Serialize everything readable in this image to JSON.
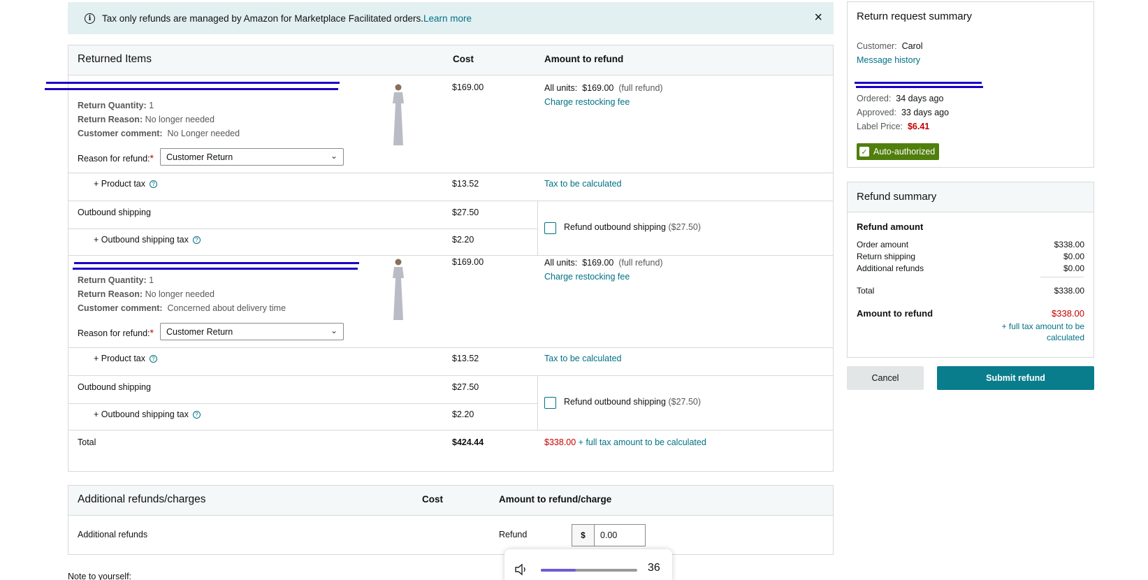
{
  "banner": {
    "text": "Tax only refunds are managed by Amazon for Marketplace Facilitated orders.",
    "link": "Learn more",
    "close": "×"
  },
  "items_table": {
    "title": "Returned Items",
    "col_cost": "Cost",
    "col_amount": "Amount to refund",
    "items": [
      {
        "return_quantity_label": "Return Quantity:",
        "return_quantity": "1",
        "return_reason_label": "Return Reason:",
        "return_reason": "No longer needed",
        "customer_comment_label": "Customer comment:",
        "customer_comment": "No Longer needed",
        "reason_for_refund_label": "Reason for refund:",
        "reason_for_refund": "Customer Return",
        "cost": "$169.00",
        "all_units_label": "All units:",
        "all_units_value": "$169.00",
        "all_units_note": "(full refund)",
        "restocking": "Charge restocking fee",
        "product_tax_label": "+ Product tax",
        "product_tax_cost": "$13.52",
        "product_tax_refund": "Tax to be calculated",
        "outbound_label": "Outbound shipping",
        "outbound_cost": "$27.50",
        "outbound_tax_label": "+ Outbound shipping tax",
        "outbound_tax_cost": "$2.20",
        "refund_outbound_label": "Refund outbound shipping",
        "refund_outbound_amount": "($27.50)"
      },
      {
        "return_quantity_label": "Return Quantity:",
        "return_quantity": "1",
        "return_reason_label": "Return Reason:",
        "return_reason": "No longer needed",
        "customer_comment_label": "Customer comment:",
        "customer_comment": "Concerned about delivery time",
        "reason_for_refund_label": "Reason for refund:",
        "reason_for_refund": "Customer Return",
        "cost": "$169.00",
        "all_units_label": "All units:",
        "all_units_value": "$169.00",
        "all_units_note": "(full refund)",
        "restocking": "Charge restocking fee",
        "product_tax_label": "+ Product tax",
        "product_tax_cost": "$13.52",
        "product_tax_refund": "Tax to be calculated",
        "outbound_label": "Outbound shipping",
        "outbound_cost": "$27.50",
        "outbound_tax_label": "+ Outbound shipping tax",
        "outbound_tax_cost": "$2.20",
        "refund_outbound_label": "Refund outbound shipping",
        "refund_outbound_amount": "($27.50)"
      }
    ],
    "total_label": "Total",
    "total_cost": "$424.44",
    "total_refund": "$338.00",
    "total_refund_note": "+ full tax amount to be calculated"
  },
  "additional": {
    "title": "Additional refunds/charges",
    "col_cost": "Cost",
    "col_amount": "Amount to refund/charge",
    "row_label": "Additional refunds",
    "refund_label": "Refund",
    "currency": "$",
    "value": "0.00"
  },
  "note_label": "Note to yourself:",
  "volume": {
    "value": "36",
    "level": 0.36
  },
  "summary": {
    "title": "Return request summary",
    "customer_label": "Customer:",
    "customer": "Carol",
    "message_history": "Message history",
    "ordered_label": "Ordered:",
    "ordered": "34 days ago",
    "approved_label": "Approved:",
    "approved": "33 days ago",
    "label_price_label": "Label Price:",
    "label_price": "$6.41",
    "badge": "Auto-authorized"
  },
  "refund_summary": {
    "title": "Refund summary",
    "amount_heading": "Refund amount",
    "order_amount_label": "Order amount",
    "order_amount": "$338.00",
    "return_shipping_label": "Return shipping",
    "return_shipping": "$0.00",
    "additional_label": "Additional refunds",
    "additional": "$0.00",
    "total_label": "Total",
    "total": "$338.00",
    "amount_to_refund_label": "Amount to refund",
    "amount_to_refund": "$338.00",
    "tax_note": "+ full tax amount to be calculated"
  },
  "buttons": {
    "cancel": "Cancel",
    "submit": "Submit refund"
  },
  "colors": {
    "link": "#007185",
    "red": "#c40000",
    "badge": "#507f0d",
    "submit": "#0a7d8c",
    "redaction": "#1a00c8"
  }
}
